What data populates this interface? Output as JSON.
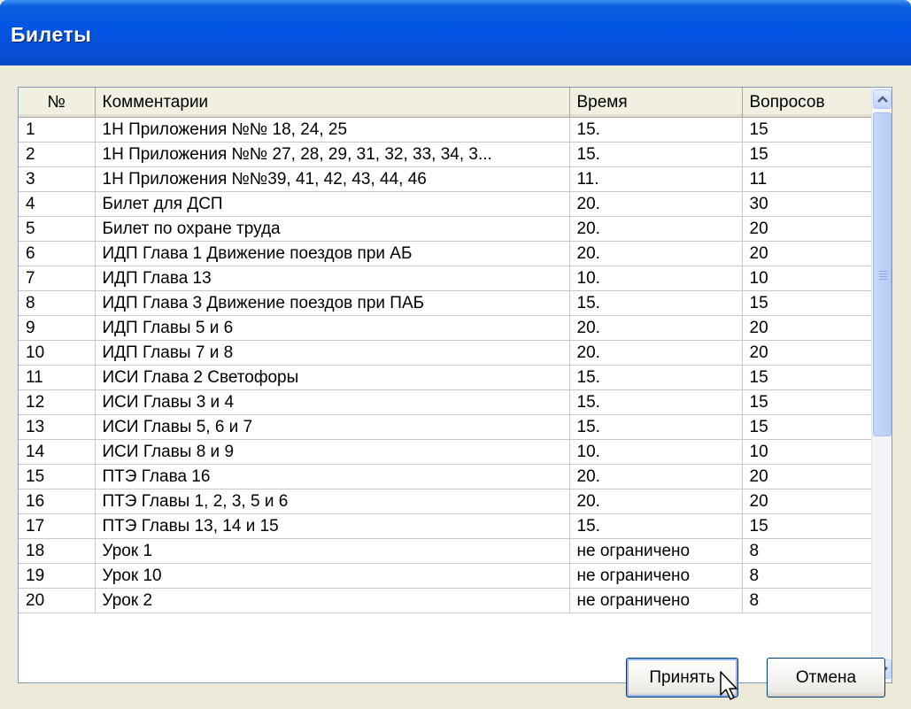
{
  "window": {
    "title": "Билеты"
  },
  "table": {
    "headers": [
      "№",
      "Комментарии",
      "Время",
      "Вопросов"
    ],
    "rows": [
      [
        "1",
        "1Н Приложения №№ 18, 24, 25",
        "15.",
        "15"
      ],
      [
        "2",
        "1Н Приложения №№ 27, 28, 29, 31, 32, 33, 34, 3...",
        "15.",
        "15"
      ],
      [
        "3",
        "1Н Приложения №№39, 41, 42, 43, 44, 46",
        "11.",
        "11"
      ],
      [
        "4",
        "Билет для ДСП",
        "20.",
        "30"
      ],
      [
        "5",
        "Билет по охране труда",
        "20.",
        "20"
      ],
      [
        "6",
        "ИДП Глава 1 Движение поездов при АБ",
        "20.",
        "20"
      ],
      [
        "7",
        "ИДП Глава 13",
        "10.",
        "10"
      ],
      [
        "8",
        "ИДП Глава 3 Движение поездов при ПАБ",
        "15.",
        "15"
      ],
      [
        "9",
        "ИДП Главы 5 и 6",
        "20.",
        "20"
      ],
      [
        "10",
        "ИДП Главы 7 и 8",
        "20.",
        "20"
      ],
      [
        "11",
        "ИСИ Глава 2 Светофоры",
        "15.",
        "15"
      ],
      [
        "12",
        "ИСИ Главы 3 и 4",
        "15.",
        "15"
      ],
      [
        "13",
        "ИСИ Главы 5, 6 и 7",
        "15.",
        "15"
      ],
      [
        "14",
        "ИСИ Главы 8 и 9",
        "10.",
        "10"
      ],
      [
        "15",
        "ПТЭ Глава 16",
        "20.",
        "20"
      ],
      [
        "16",
        "ПТЭ Главы 1, 2, 3, 5 и 6",
        "20.",
        "20"
      ],
      [
        "17",
        "ПТЭ Главы 13, 14 и 15",
        "15.",
        "15"
      ],
      [
        "18",
        "Урок 1",
        "не ограничено",
        "8"
      ],
      [
        "19",
        "Урок 10",
        "не ограничено",
        "8"
      ],
      [
        "20",
        "Урок 2",
        "не ограничено",
        "8"
      ]
    ]
  },
  "buttons": {
    "accept": "Принять",
    "cancel": "Отмена"
  },
  "icons": {
    "scroll_up": "chevron-up-icon",
    "scroll_down": "chevron-down-icon",
    "cursor": "mouse-pointer-icon"
  },
  "colors": {
    "titlebar": "#0054e3",
    "window_bg": "#ece9d8",
    "button_border": "#003c74"
  }
}
